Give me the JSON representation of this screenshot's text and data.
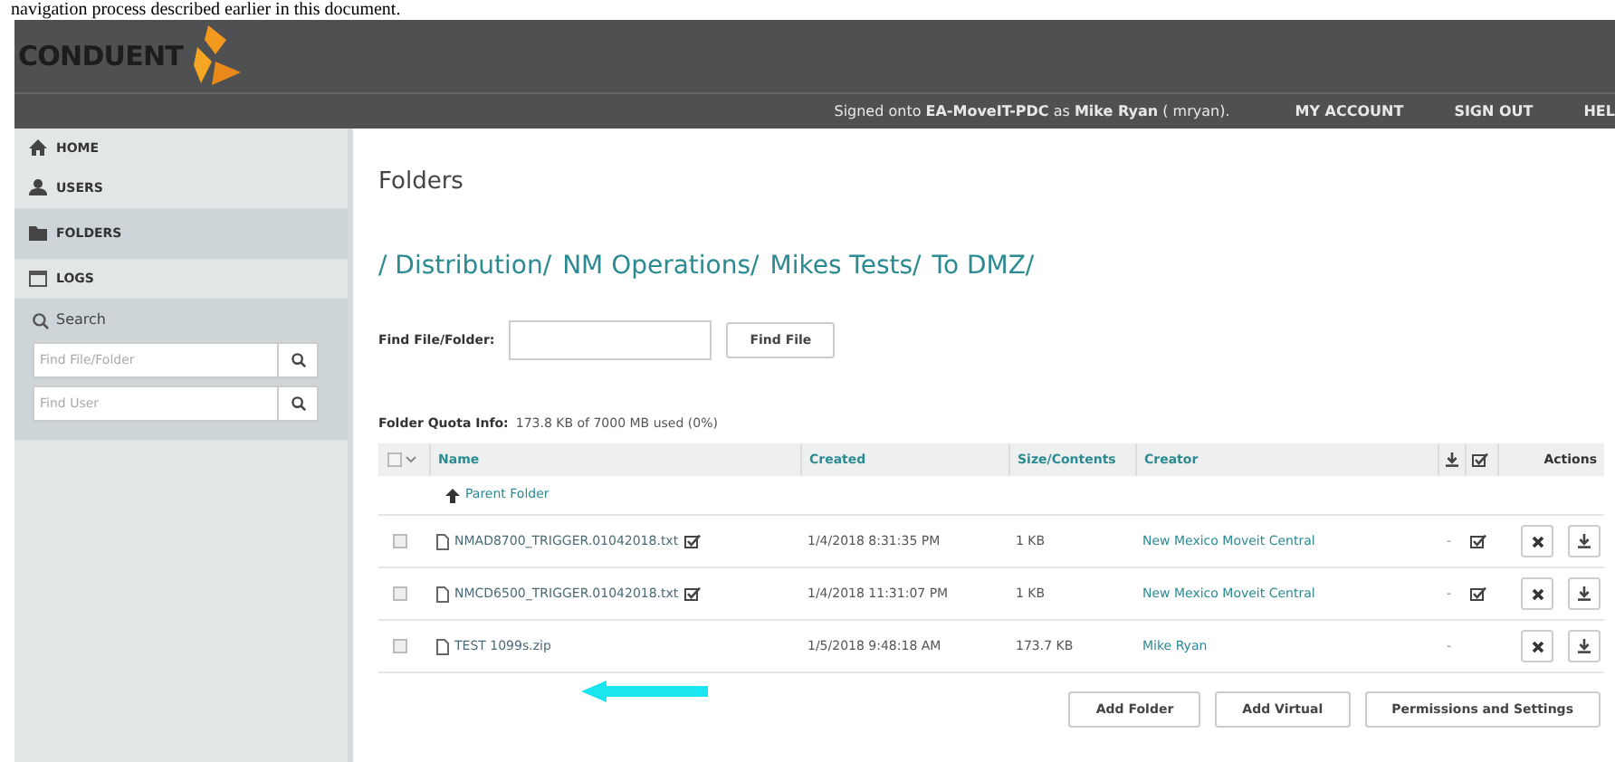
{
  "document_text": "navigation process described earlier in this document.",
  "header": {
    "logo": "CONDUENT",
    "signed_on": "Signed onto **EA-MoveIT-PDC** as **Mike Ryan** ( mryan).",
    "links": [
      "MY ACCOUNT",
      "SIGN OUT",
      "HEL"
    ]
  },
  "sidebar": {
    "items": [
      {
        "label": "HOME",
        "selected": false
      },
      {
        "label": "USERS",
        "selected": false
      },
      {
        "label": "FOLDERS",
        "selected": true
      },
      {
        "label": "LOGS",
        "selected": false
      }
    ],
    "search": {
      "title": "Search",
      "fields": [
        {
          "placeholder": "Find File/Folder"
        },
        {
          "placeholder": "Find User"
        }
      ]
    }
  },
  "main": {
    "title": "Folders",
    "breadcrumb": [
      "/ Distribution/",
      "NM Operations/",
      "Mikes Tests/",
      "To DMZ/"
    ],
    "find": {
      "label": "Find File/Folder:",
      "button": "Find File"
    },
    "quota": {
      "label": "Folder Quota Info:",
      "value": "173.8 KB of 7000 MB used (0%)"
    },
    "table": {
      "select_all_checked": false,
      "columns": [
        "Name",
        "Created",
        "Size/Contents",
        "Creator",
        "Actions"
      ],
      "parent_link": "Parent Folder",
      "rows": [
        {
          "selected": false,
          "name": "NMAD8700_TRIGGER.01042018.txt",
          "verified": true,
          "created": "1/4/2018 8:31:35 PM",
          "size": "1 KB",
          "creator": "New Mexico Moveit Central",
          "download_mark": "-",
          "checked": true
        },
        {
          "selected": false,
          "name": "NMCD6500_TRIGGER.01042018.txt",
          "verified": true,
          "created": "1/4/2018 11:31:07 PM",
          "size": "1 KB",
          "creator": "New Mexico Moveit Central",
          "download_mark": "-",
          "checked": true
        },
        {
          "selected": false,
          "name": "TEST 1099s.zip",
          "verified": false,
          "created": "1/5/2018 9:48:18 AM",
          "size": "173.7 KB",
          "creator": "Mike Ryan",
          "download_mark": "-",
          "checked": false
        }
      ]
    },
    "buttons": [
      "Add Folder",
      "Add Virtual",
      "Permissions and Settings"
    ]
  }
}
